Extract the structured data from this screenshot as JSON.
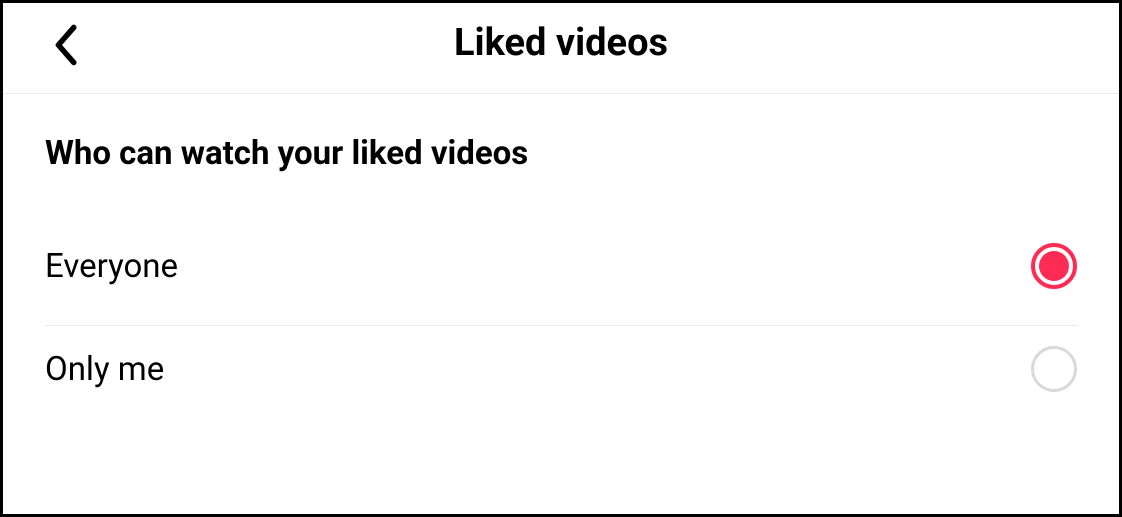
{
  "header": {
    "title": "Liked videos"
  },
  "section": {
    "heading": "Who can watch your liked videos",
    "options": [
      {
        "label": "Everyone",
        "selected": true
      },
      {
        "label": "Only me",
        "selected": false
      }
    ]
  },
  "colors": {
    "accent": "#fe2c55"
  }
}
